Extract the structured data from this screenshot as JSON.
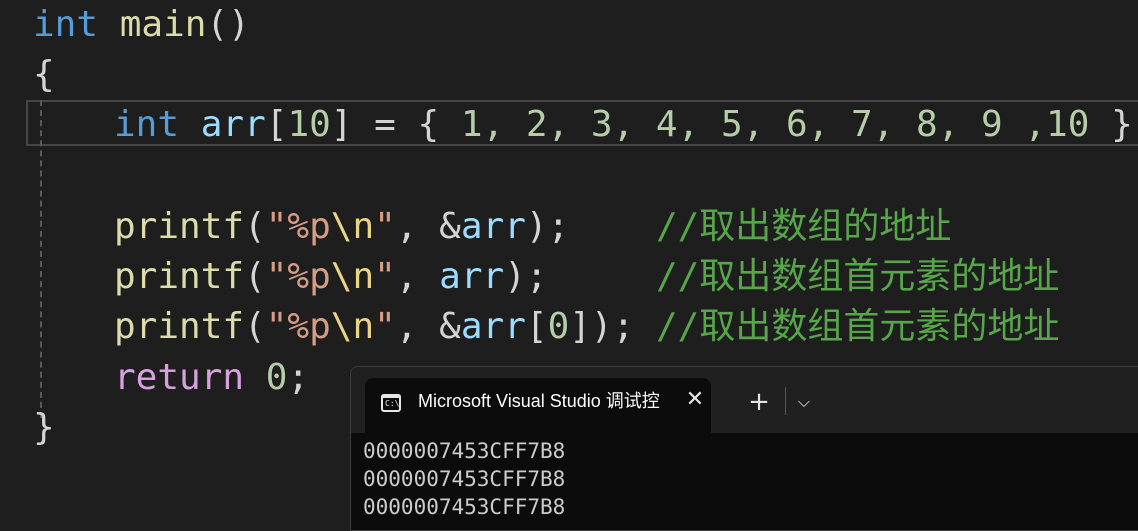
{
  "editor": {
    "line1": {
      "type": "int",
      "name": "main",
      "parens": "()"
    },
    "line2": {
      "brace": "{"
    },
    "line3": {
      "type": "int",
      "var": "arr",
      "lbr": "[",
      "size": "10",
      "rbr": "]",
      "assign": " = { ",
      "values": "1, 2, 3, 4, 5, 6, 7, 8, 9 ,10",
      "end": " };"
    },
    "line4": {
      "fn": "printf",
      "open": "(",
      "str_open": "\"%p",
      "esc": "\\n",
      "str_close": "\"",
      "comma": ", &",
      "arg": "arr",
      "close": ");",
      "comment": "//取出数组的地址"
    },
    "line5": {
      "fn": "printf",
      "open": "(",
      "str_open": "\"%p",
      "esc": "\\n",
      "str_close": "\"",
      "comma": ", ",
      "arg": "arr",
      "close": ");",
      "comment": "//取出数组首元素的地址"
    },
    "line6": {
      "fn": "printf",
      "open": "(",
      "str_open": "\"%p",
      "esc": "\\n",
      "str_close": "\"",
      "comma": ", &",
      "arg": "arr",
      "lbr": "[",
      "idx": "0",
      "close": "]);",
      "comment": "//取出数组首元素的地址"
    },
    "line7": {
      "kw": "return",
      "val": "0",
      "end": ";"
    },
    "line8": {
      "brace": "}"
    }
  },
  "terminal": {
    "tab_icon": "console-icon",
    "tab_icon_text": "C:\\",
    "tab_title": "Microsoft Visual Studio 调试控",
    "close_glyph": "✕",
    "new_tab_glyph": "+",
    "dropdown_glyph": "⌵",
    "output": [
      "0000007453CFF7B8",
      "0000007453CFF7B8",
      "0000007453CFF7B8"
    ]
  }
}
